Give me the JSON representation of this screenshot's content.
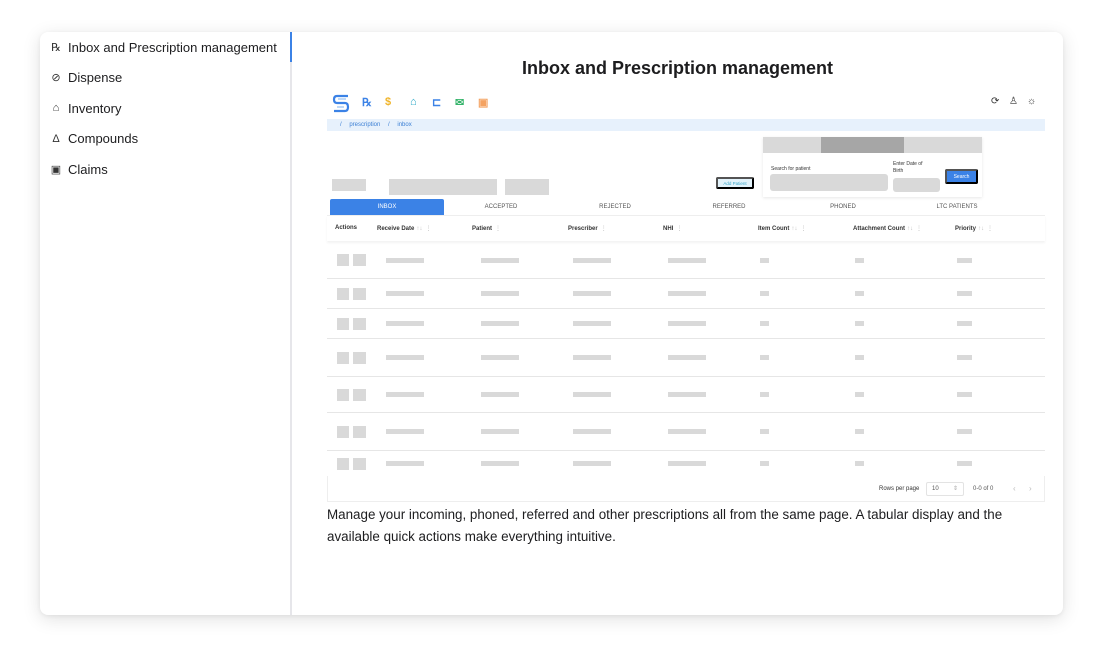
{
  "sidebar": {
    "items": [
      {
        "label": "Inbox and Prescription management",
        "icon": "prescription-icon",
        "glyph": "℞",
        "active": true
      },
      {
        "label": "Dispense",
        "icon": "pill-icon",
        "glyph": "⊘",
        "active": false
      },
      {
        "label": "Inventory",
        "icon": "warehouse-icon",
        "glyph": "⌂",
        "active": false
      },
      {
        "label": "Compounds",
        "icon": "flask-icon",
        "glyph": "Δ",
        "active": false
      },
      {
        "label": "Claims",
        "icon": "clipboard-dollar-icon",
        "glyph": "▣",
        "active": false
      }
    ]
  },
  "main": {
    "title": "Inbox and Prescription management",
    "description": "Manage your incoming, phoned, referred and other prescriptions all from the same page. A tabular display and the available quick actions make everything intuitive."
  },
  "app": {
    "toolbar_icons": [
      {
        "name": "prescription-icon",
        "glyph": "℞",
        "color": "#3b82e6"
      },
      {
        "name": "dollar-icon",
        "glyph": "$",
        "color": "#f0b429"
      },
      {
        "name": "warehouse-icon",
        "glyph": "⌂",
        "color": "#20a4c4"
      },
      {
        "name": "cart-icon",
        "glyph": "⊏",
        "color": "#3b82e6"
      },
      {
        "name": "mail-icon",
        "glyph": "✉",
        "color": "#34b36a"
      },
      {
        "name": "form-icon",
        "glyph": "▣",
        "color": "#f4a261"
      }
    ],
    "right_icons": [
      {
        "name": "refresh-icon",
        "glyph": "⟳"
      },
      {
        "name": "user-icon",
        "glyph": "♙"
      },
      {
        "name": "sun-icon",
        "glyph": "☼"
      }
    ],
    "breadcrumb": [
      "/",
      "prescription",
      "/",
      "inbox"
    ],
    "search": {
      "patient_label": "Search for patient",
      "dob_label": "Enter Date of Birth",
      "button": "Search"
    },
    "add_patient": "Add Patient",
    "tabs": [
      "INBOX",
      "ACCEPTED",
      "REJECTED",
      "REFERRED",
      "PHONED",
      "LTC PATIENTS"
    ],
    "active_tab": "INBOX",
    "columns": [
      {
        "label": "Actions",
        "sortable": false,
        "menu": false
      },
      {
        "label": "Receive Date",
        "sortable": true,
        "menu": true
      },
      {
        "label": "Patient",
        "sortable": false,
        "menu": true
      },
      {
        "label": "Prescriber",
        "sortable": false,
        "menu": true
      },
      {
        "label": "NHI",
        "sortable": false,
        "menu": true
      },
      {
        "label": "Item Count",
        "sortable": true,
        "menu": true
      },
      {
        "label": "Attachment Count",
        "sortable": true,
        "menu": true
      },
      {
        "label": "Priority",
        "sortable": true,
        "menu": true
      }
    ],
    "skeleton_row_count": 7,
    "pagination": {
      "rows_per_page_label": "Rows per page",
      "rows_per_page": "10",
      "range": "0-0 of 0"
    },
    "accent": "#3b82e6"
  }
}
